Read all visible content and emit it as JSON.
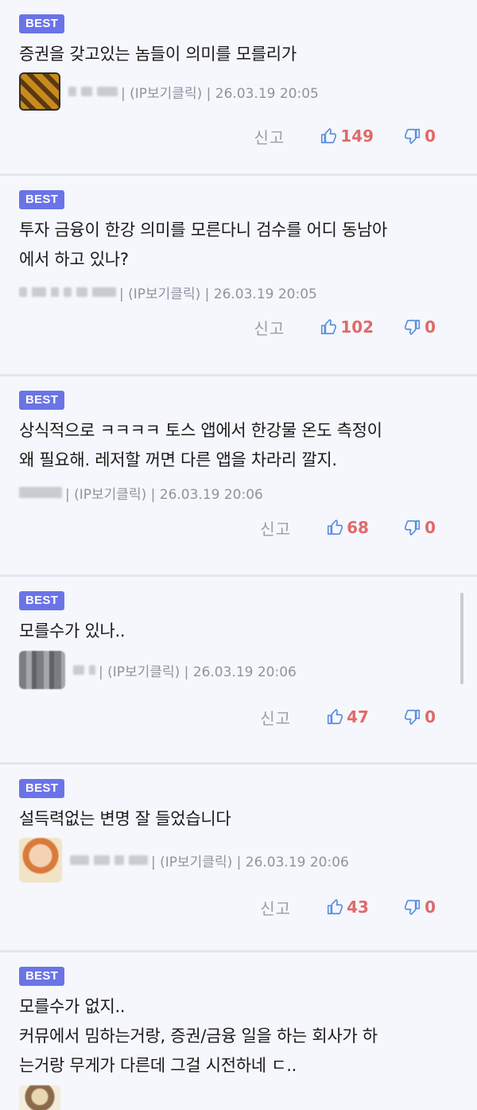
{
  "comments": [
    {
      "badge": "BEST",
      "text": "증권을 갖고있는 놈들이 의미를 모를리가",
      "meta": "| (IP보기클릭) | 26.03.19 20:05",
      "report": "신고",
      "likes": "149",
      "dislikes": "0"
    },
    {
      "badge": "BEST",
      "text": "투자 금융이 한강 의미를 모른다니 검수를 어디 동남아\n에서 하고 있나?",
      "meta": "| (IP보기클릭) | 26.03.19 20:05",
      "report": "신고",
      "likes": "102",
      "dislikes": "0"
    },
    {
      "badge": "BEST",
      "text": "상식적으로 ㅋㅋㅋㅋ 토스 앱에서 한강물 온도 측정이\n왜 필요해. 레저할 꺼면 다른 앱을 차라리 깔지.",
      "meta": "| (IP보기클릭) | 26.03.19 20:06",
      "report": "신고",
      "likes": "68",
      "dislikes": "0"
    },
    {
      "badge": "BEST",
      "text": "모를수가 있나..",
      "meta": "| (IP보기클릭) | 26.03.19 20:06",
      "report": "신고",
      "likes": "47",
      "dislikes": "0"
    },
    {
      "badge": "BEST",
      "text": "설득력없는 변명 잘 들었습니다",
      "meta": "| (IP보기클릭) | 26.03.19 20:06",
      "report": "신고",
      "likes": "43",
      "dislikes": "0"
    },
    {
      "badge": "BEST",
      "text": "모를수가 없지..\n커뮤에서 밈하는거랑, 증권/금융 일을 하는 회사가 하\n는거랑 무게가 다른데 그걸 시전하네 ㄷ..",
      "meta": "",
      "report": "",
      "likes": "",
      "dislikes": ""
    }
  ],
  "icons": {
    "like": "thumbs-up-icon",
    "dislike": "thumbs-down-icon"
  },
  "colors": {
    "badge": "#6a74e6",
    "count": "#e06a6a",
    "thumb": "#5a8ede",
    "background": "#f5f7fc"
  }
}
